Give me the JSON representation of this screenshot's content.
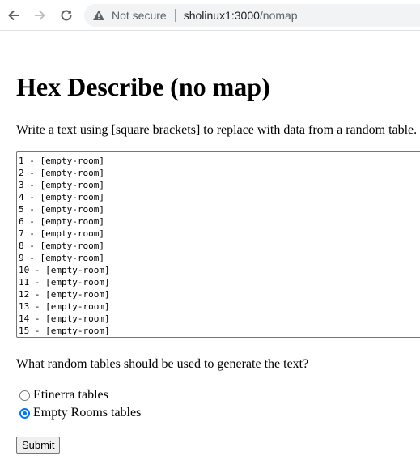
{
  "browser": {
    "security_label": "Not secure",
    "url_host": "sholinux1:3000",
    "url_path": "/nomap"
  },
  "page": {
    "title": "Hex Describe (no map)",
    "intro": "Write a text using [square brackets] to replace with data from a random table.",
    "textarea_value": "1 - [empty-room]\n2 - [empty-room]\n3 - [empty-room]\n4 - [empty-room]\n5 - [empty-room]\n6 - [empty-room]\n7 - [empty-room]\n8 - [empty-room]\n9 - [empty-room]\n10 - [empty-room]\n11 - [empty-room]\n12 - [empty-room]\n13 - [empty-room]\n14 - [empty-room]\n15 - [empty-room]",
    "question": "What random tables should be used to generate the text?",
    "options": [
      {
        "label": "Etinerra tables",
        "checked": false
      },
      {
        "label": "Empty Rooms tables",
        "checked": true
      }
    ],
    "submit_label": "Submit"
  },
  "colors": {
    "accent": "#0075ff",
    "icon": "#5f6368"
  }
}
